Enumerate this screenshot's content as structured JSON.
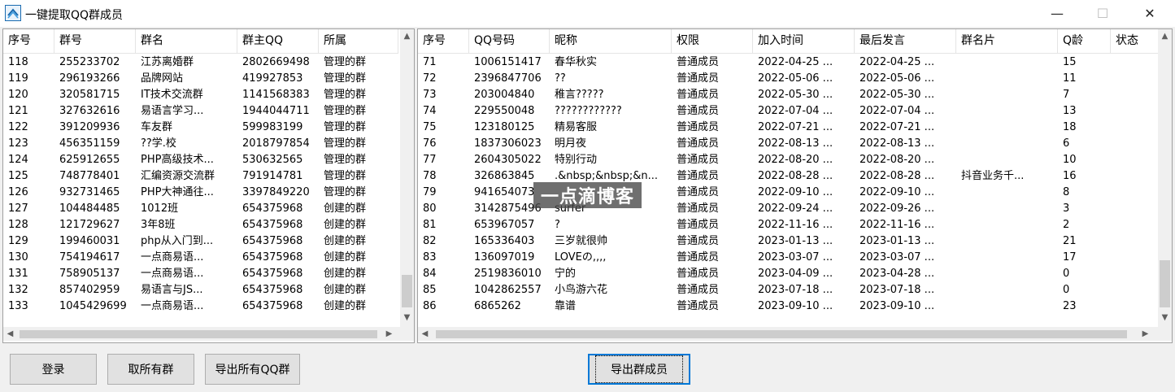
{
  "window": {
    "title": "一键提取QQ群成员",
    "minimize_glyph": "—",
    "maximize_glyph": "☐",
    "close_glyph": "✕"
  },
  "left_table": {
    "columns": [
      "序号",
      "群号",
      "群名",
      "群主QQ",
      "所属"
    ],
    "rows": [
      [
        "118",
        "255233702",
        "江苏离婚群",
        "2802669498",
        "管理的群"
      ],
      [
        "119",
        "296193266",
        "品牌网站",
        "419927853",
        "管理的群"
      ],
      [
        "120",
        "320581715",
        "IT技术交流群",
        "1141568383",
        "管理的群"
      ],
      [
        "121",
        "327632616",
        "易语言学习...",
        "1944044711",
        "管理的群"
      ],
      [
        "122",
        "391209936",
        "车友群",
        "599983199",
        "管理的群"
      ],
      [
        "123",
        "456351159",
        "??学.校",
        "2018797854",
        "管理的群"
      ],
      [
        "124",
        "625912655",
        "PHP高级技术...",
        "530632565",
        "管理的群"
      ],
      [
        "125",
        "748778401",
        "汇编资源交流群",
        "791914781",
        "管理的群"
      ],
      [
        "126",
        "932731465",
        "PHP大神通往...",
        "3397849220",
        "管理的群"
      ],
      [
        "127",
        "104484485",
        "1012班",
        "654375968",
        "创建的群"
      ],
      [
        "128",
        "121729627",
        "3年8班",
        "654375968",
        "创建的群"
      ],
      [
        "129",
        "199460031",
        "php从入门到...",
        "654375968",
        "创建的群"
      ],
      [
        "130",
        "754194617",
        "一点商易语...",
        "654375968",
        "创建的群"
      ],
      [
        "131",
        "758905137",
        "一点商易语...",
        "654375968",
        "创建的群"
      ],
      [
        "132",
        "857402959",
        "易语言与JS...",
        "654375968",
        "创建的群"
      ],
      [
        "133",
        "1045429699",
        "一点商易语...",
        "654375968",
        "创建的群"
      ]
    ]
  },
  "right_table": {
    "columns": [
      "序号",
      "QQ号码",
      "昵称",
      "权限",
      "加入时间",
      "最后发言",
      "群名片",
      "Q龄",
      "状态"
    ],
    "rows": [
      [
        "71",
        "1006151417",
        "春华秋实",
        "普通成员",
        "2022-04-25 ...",
        "2022-04-25 ...",
        "",
        "15",
        ""
      ],
      [
        "72",
        "2396847706",
        "??",
        "普通成员",
        "2022-05-06 ...",
        "2022-05-06 ...",
        "",
        "11",
        ""
      ],
      [
        "73",
        "203004840",
        "稚言?????",
        "普通成员",
        "2022-05-30 ...",
        "2022-05-30 ...",
        "",
        "7",
        ""
      ],
      [
        "74",
        "229550048",
        "????????????",
        "普通成员",
        "2022-07-04 ...",
        "2022-07-04 ...",
        "",
        "13",
        ""
      ],
      [
        "75",
        "123180125",
        "精易客服",
        "普通成员",
        "2022-07-21 ...",
        "2022-07-21 ...",
        "",
        "18",
        ""
      ],
      [
        "76",
        "1837306023",
        "明月夜",
        "普通成员",
        "2022-08-13 ...",
        "2022-08-13 ...",
        "",
        "6",
        ""
      ],
      [
        "77",
        "2604305022",
        "特别行动",
        "普通成员",
        "2022-08-20 ...",
        "2022-08-20 ...",
        "",
        "10",
        ""
      ],
      [
        "78",
        "326863845",
        ".&nbsp;&nbsp;&n...",
        "普通成员",
        "2022-08-28 ...",
        "2022-08-28 ...",
        "抖音业务千...",
        "16",
        ""
      ],
      [
        "79",
        "941654073",
        "",
        "普通成员",
        "2022-09-10 ...",
        "2022-09-10 ...",
        "",
        "8",
        ""
      ],
      [
        "80",
        "3142875496",
        "surfer",
        "普通成员",
        "2022-09-24 ...",
        "2022-09-26 ...",
        "",
        "3",
        ""
      ],
      [
        "81",
        "653967057",
        "?",
        "普通成员",
        "2022-11-16 ...",
        "2022-11-16 ...",
        "",
        "2",
        ""
      ],
      [
        "82",
        "165336403",
        "三岁就很帅",
        "普通成员",
        "2023-01-13 ...",
        "2023-01-13 ...",
        "",
        "21",
        ""
      ],
      [
        "83",
        "136097019",
        "LOVEの,,,,",
        "普通成员",
        "2023-03-07 ...",
        "2023-03-07 ...",
        "",
        "17",
        ""
      ],
      [
        "84",
        "2519836010",
        "宁的",
        "普通成员",
        "2023-04-09 ...",
        "2023-04-28 ...",
        "",
        "0",
        ""
      ],
      [
        "85",
        "1042862557",
        "小鸟游六花",
        "普通成员",
        "2023-07-18 ...",
        "2023-07-18 ...",
        "",
        "0",
        ""
      ],
      [
        "86",
        "6865262",
        "靠谱",
        "普通成员",
        "2023-09-10 ...",
        "2023-09-10 ...",
        "",
        "23",
        ""
      ]
    ]
  },
  "buttons": {
    "login": "登录",
    "fetch_groups": "取所有群",
    "export_groups": "导出所有QQ群",
    "export_members": "导出群成员"
  },
  "watermark": "一点滴博客",
  "scroll": {
    "up_glyph": "▲",
    "down_glyph": "▼",
    "left_glyph": "◀",
    "right_glyph": "▶"
  }
}
